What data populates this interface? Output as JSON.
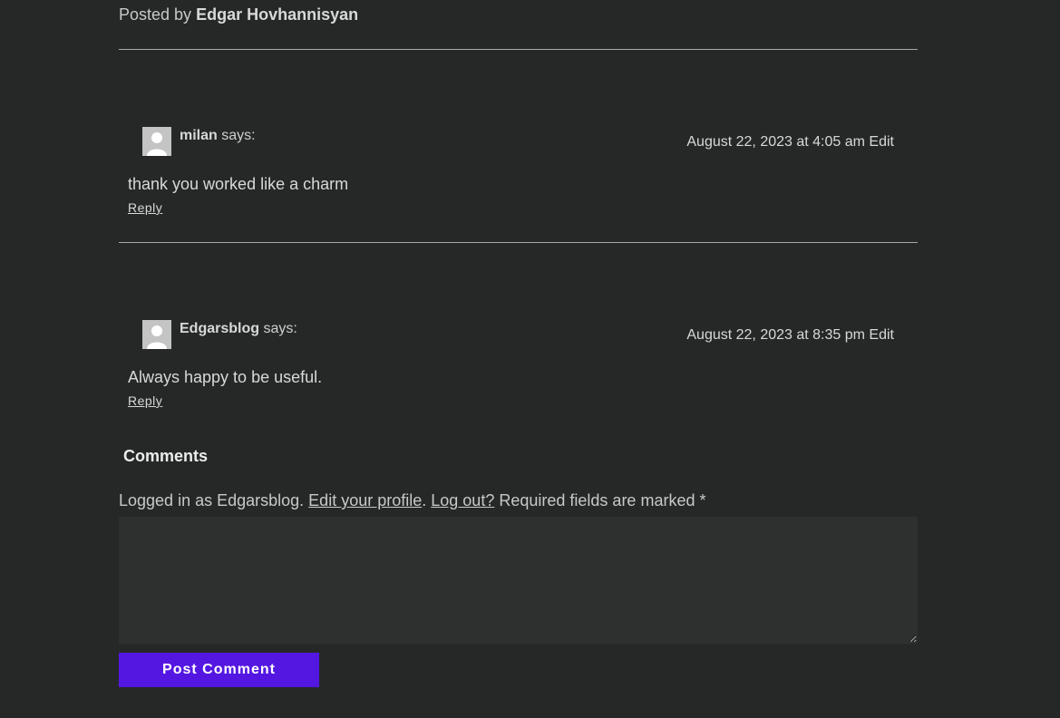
{
  "post": {
    "posted_by_prefix": "Posted by",
    "author": "Edgar Hovhannisyan"
  },
  "comments": [
    {
      "author": "milan",
      "says": "says:",
      "date": "August 22, 2023 at 4:05 am",
      "edit": "Edit",
      "text": "thank you worked like a charm",
      "reply": "Reply"
    },
    {
      "author": "Edgarsblog",
      "says": "says:",
      "date": "August 22, 2023 at 8:35 pm",
      "edit": "Edit",
      "text": "Always happy to be useful.",
      "reply": "Reply"
    }
  ],
  "form": {
    "title": "Comments",
    "logged_in_prefix": "Logged in as Edgarsblog.",
    "edit_profile": "Edit your profile",
    "separator": ".",
    "log_out": "Log out?",
    "required_note": "Required fields are marked",
    "required_mark": "*",
    "textarea_value": "",
    "submit_label": "Post Comment"
  },
  "colors": {
    "background": "#262828",
    "button": "#5417e2",
    "textarea": "#2e2f2f"
  }
}
